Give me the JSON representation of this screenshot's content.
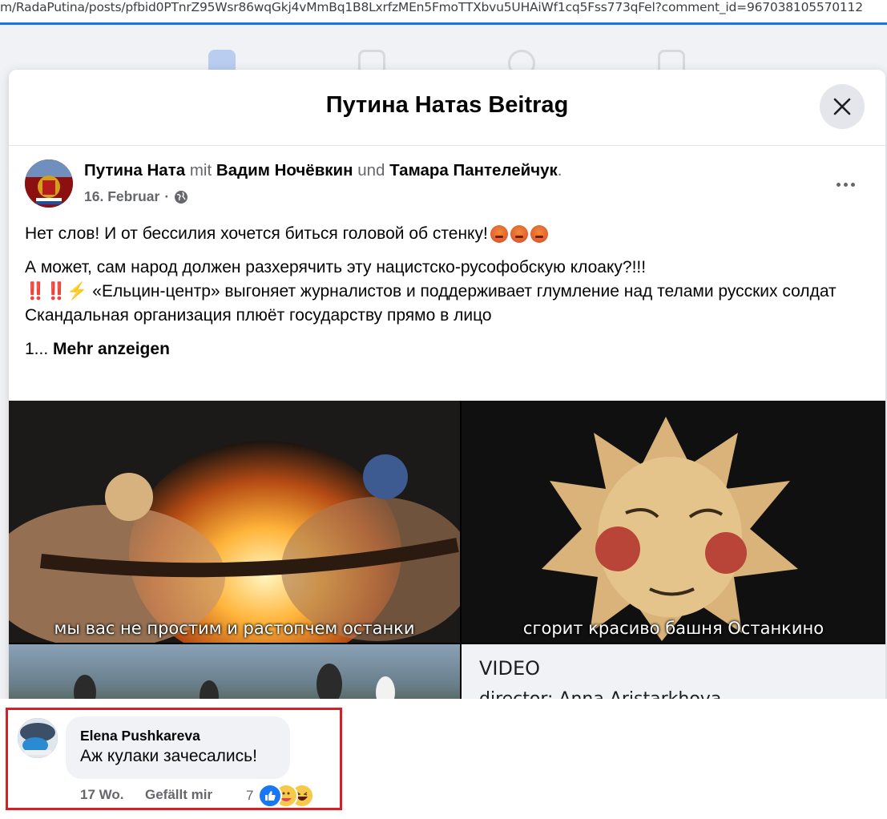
{
  "browser": {
    "url": "m/RadaPutina/posts/pfbid0PTnrZ95Wsr86wqGkj4vMmBq1B8LxrfzMEn5FmoTTXbvu5UHAiWf1cq5Fss773qFel?comment_id=967038105570112"
  },
  "dialog": {
    "title": "Путина Натаs Beitrag",
    "close_icon": "close-icon"
  },
  "post": {
    "author": "Путина Ната",
    "with_word": "mit",
    "tag1": "Вадим Ночёвкин",
    "and_word": "und",
    "tag2": "Тамара Пантелейчук",
    "period": ".",
    "date": "16. Februar",
    "separator": "·",
    "privacy_icon": "globe-icon",
    "line1": "Нет слов! И от бессилия хочется биться головой об стенку!",
    "line2": "А может, сам народ должен разхерячить эту нацистско-русофобскую клоаку?!!!",
    "line3_emoji": "‼️‼️⚡",
    "line3": "«Ельцин-центр» выгоняет журналистов и поддерживает глумление над телами русских солдат",
    "line4": "Скандальная организация плюёт государству прямо в лицо",
    "truncated_prefix": "1...",
    "see_more": "Mehr anzeigen"
  },
  "media": {
    "caption1": "мы вас не простим и растопчем останки",
    "caption2": "сгорит красиво башня Останкино",
    "video_label": "VIDEO",
    "video_sub": "director: Anna Aristarkhova"
  },
  "comment": {
    "author": "Elena Pushkareva",
    "text": "Аж кулаки зачесались!",
    "age": "17 Wo.",
    "like_action": "Gefällt mir",
    "reaction_count": "7",
    "reactions": [
      "like-icon",
      "care-icon",
      "haha-icon"
    ]
  },
  "colors": {
    "highlight_frame": "#d61f26",
    "link_blue": "#1877f2",
    "muted": "#65676b"
  }
}
